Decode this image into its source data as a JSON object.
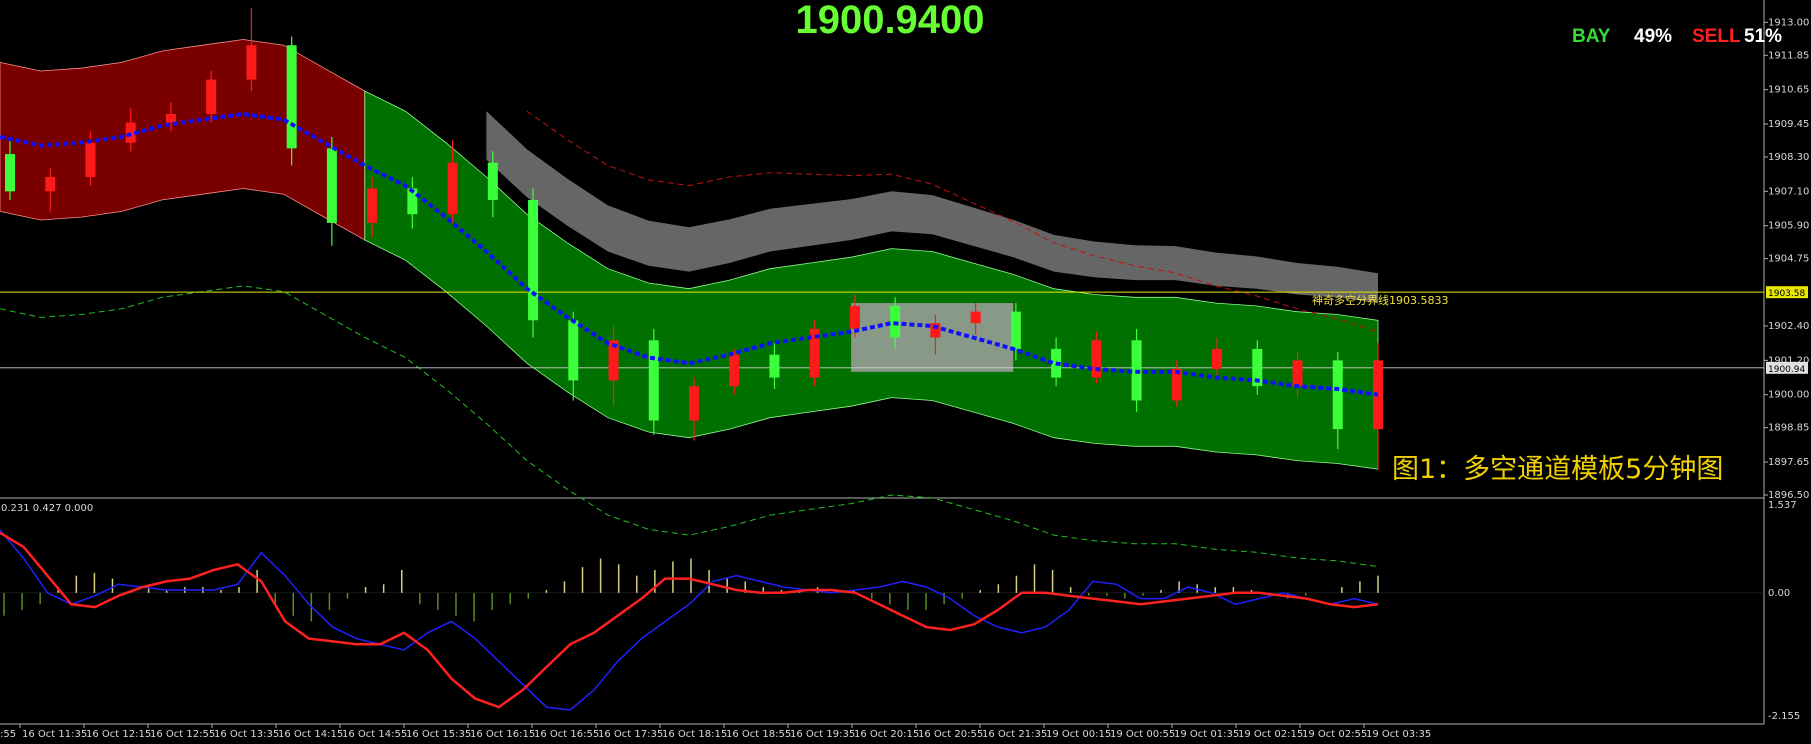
{
  "header": {
    "price": "1900.9400",
    "bay_label": "BAY",
    "bay_pct": "49%",
    "sell_label": "SELL",
    "sell_pct": "51%"
  },
  "colors": {
    "background": "#000000",
    "bull_candle": "#ff1a1a",
    "bear_candle": "#3cff3c",
    "bull_channel": "#7a0000",
    "bear_channel": "#007000",
    "grey_cloud": "#6b6b6b",
    "flat_zone": "#a0a0a0",
    "midline": "#1010ff",
    "signal_line": "#ff2020",
    "macd_line": "#2020ff",
    "boundary_line": "#e8e800",
    "price_text": "#66ff33",
    "caption": "#f0d000"
  },
  "chart_data": [
    {
      "type": "candlestick",
      "panel": "price",
      "y_ticks": [
        "1913.00",
        "1911.85",
        "1910.65",
        "1909.45",
        "1908.30",
        "1907.10",
        "1905.90",
        "1904.75",
        "1902.40",
        "1901.20",
        "1900.00",
        "1898.85",
        "1897.65",
        "1896.50"
      ],
      "ylim": [
        1896.5,
        1913.5
      ],
      "current_price_tag": "1900.94",
      "boundary": {
        "value": 1903.58,
        "tag": "1903.58",
        "label": "神奇多空分界线1903.5833"
      },
      "x_labels": [
        "16 Oct 11:35",
        "16 Oct 12:15",
        "16 Oct 12:55",
        "16 Oct 13:35",
        "16 Oct 14:15",
        "16 Oct 14:55",
        "16 Oct 15:35",
        "16 Oct 16:15",
        "16 Oct 16:55",
        "16 Oct 17:35",
        "16 Oct 18:15",
        "16 Oct 18:55",
        "16 Oct 19:35",
        "16 Oct 20:15",
        "16 Oct 20:55",
        "16 Oct 21:35",
        "19 Oct 00:15",
        "19 Oct 00:55",
        "19 Oct 01:35",
        "19 Oct 02:15",
        "19 Oct 02:55",
        "19 Oct 03:35"
      ],
      "x_label_leading": ":55",
      "caption": "图1：多空通道模板5分钟图",
      "midline": [
        1909.0,
        1908.7,
        1908.8,
        1909.0,
        1909.4,
        1909.6,
        1909.8,
        1909.6,
        1908.8,
        1908.0,
        1907.3,
        1906.2,
        1905.0,
        1903.7,
        1902.7,
        1901.8,
        1901.3,
        1901.1,
        1901.4,
        1901.8,
        1902.0,
        1902.2,
        1902.5,
        1902.4,
        1902.0,
        1901.6,
        1901.1,
        1900.9,
        1900.8,
        1900.8,
        1900.6,
        1900.5,
        1900.3,
        1900.2,
        1900.0
      ],
      "candles": [
        {
          "o": 1908.4,
          "h": 1908.9,
          "l": 1906.8,
          "c": 1907.1
        },
        {
          "o": 1907.1,
          "h": 1907.9,
          "l": 1906.4,
          "c": 1907.6
        },
        {
          "o": 1907.6,
          "h": 1909.2,
          "l": 1907.3,
          "c": 1908.8
        },
        {
          "o": 1908.8,
          "h": 1910.0,
          "l": 1908.5,
          "c": 1909.5
        },
        {
          "o": 1909.5,
          "h": 1910.2,
          "l": 1909.2,
          "c": 1909.8
        },
        {
          "o": 1909.8,
          "h": 1911.3,
          "l": 1909.5,
          "c": 1911.0
        },
        {
          "o": 1911.0,
          "h": 1913.5,
          "l": 1910.6,
          "c": 1912.2
        },
        {
          "o": 1912.2,
          "h": 1912.5,
          "l": 1908.0,
          "c": 1908.6
        },
        {
          "o": 1908.6,
          "h": 1909.0,
          "l": 1905.2,
          "c": 1906.0
        },
        {
          "o": 1906.0,
          "h": 1907.6,
          "l": 1905.5,
          "c": 1907.2
        },
        {
          "o": 1907.2,
          "h": 1907.6,
          "l": 1905.8,
          "c": 1906.3
        },
        {
          "o": 1906.3,
          "h": 1908.9,
          "l": 1906.0,
          "c": 1908.1
        },
        {
          "o": 1908.1,
          "h": 1908.5,
          "l": 1906.2,
          "c": 1906.8
        },
        {
          "o": 1906.8,
          "h": 1907.2,
          "l": 1902.0,
          "c": 1902.6
        },
        {
          "o": 1902.6,
          "h": 1902.9,
          "l": 1899.8,
          "c": 1900.5
        },
        {
          "o": 1900.5,
          "h": 1902.4,
          "l": 1899.6,
          "c": 1901.9
        },
        {
          "o": 1901.9,
          "h": 1902.3,
          "l": 1898.6,
          "c": 1899.1
        },
        {
          "o": 1899.1,
          "h": 1900.6,
          "l": 1898.4,
          "c": 1900.3
        },
        {
          "o": 1900.3,
          "h": 1901.6,
          "l": 1900.0,
          "c": 1901.4
        },
        {
          "o": 1901.4,
          "h": 1901.8,
          "l": 1900.2,
          "c": 1900.6
        },
        {
          "o": 1900.6,
          "h": 1902.6,
          "l": 1900.3,
          "c": 1902.3
        },
        {
          "o": 1902.3,
          "h": 1903.5,
          "l": 1902.0,
          "c": 1903.1
        },
        {
          "o": 1903.1,
          "h": 1903.4,
          "l": 1901.6,
          "c": 1902.0
        },
        {
          "o": 1902.0,
          "h": 1902.8,
          "l": 1901.4,
          "c": 1902.5
        },
        {
          "o": 1902.5,
          "h": 1903.2,
          "l": 1902.1,
          "c": 1902.9
        },
        {
          "o": 1902.9,
          "h": 1903.2,
          "l": 1901.2,
          "c": 1901.6
        },
        {
          "o": 1901.6,
          "h": 1902.0,
          "l": 1900.3,
          "c": 1900.6
        },
        {
          "o": 1900.6,
          "h": 1902.2,
          "l": 1900.4,
          "c": 1901.9
        },
        {
          "o": 1901.9,
          "h": 1902.3,
          "l": 1899.4,
          "c": 1899.8
        },
        {
          "o": 1899.8,
          "h": 1901.2,
          "l": 1899.6,
          "c": 1900.9
        },
        {
          "o": 1900.9,
          "h": 1902.0,
          "l": 1900.6,
          "c": 1901.6
        },
        {
          "o": 1901.6,
          "h": 1901.9,
          "l": 1900.0,
          "c": 1900.3
        },
        {
          "o": 1900.3,
          "h": 1901.5,
          "l": 1899.9,
          "c": 1901.2
        },
        {
          "o": 1901.2,
          "h": 1901.5,
          "l": 1898.1,
          "c": 1898.8
        },
        {
          "o": 1898.8,
          "h": 1901.8,
          "l": 1897.4,
          "c": 1901.2
        }
      ]
    },
    {
      "type": "macd",
      "panel": "indicator",
      "label": "0.231 0.427 0.000",
      "y_ticks": [
        "1.537",
        "0.00",
        "-2.155"
      ],
      "ylim": [
        -2.155,
        1.537
      ],
      "histogram": [
        -0.4,
        -0.3,
        -0.2,
        0.1,
        0.3,
        0.35,
        0.25,
        0.05,
        0.1,
        0.05,
        0.1,
        0.1,
        0.05,
        0.1,
        0.4,
        -0.2,
        -0.4,
        -0.5,
        -0.3,
        -0.1,
        0.1,
        0.15,
        0.4,
        -0.2,
        -0.3,
        -0.4,
        -0.5,
        -0.3,
        -0.2,
        -0.1,
        0.05,
        0.2,
        0.45,
        0.6,
        0.5,
        0.3,
        0.4,
        0.55,
        0.6,
        0.4,
        0.25,
        0.2,
        0.1,
        0.05,
        0.05,
        0.1,
        0.05,
        0.05,
        -0.1,
        -0.2,
        -0.3,
        -0.3,
        -0.2,
        -0.1,
        0.05,
        0.15,
        0.3,
        0.5,
        0.4,
        0.1,
        -0.05,
        -0.05,
        -0.1,
        -0.05,
        0.05,
        0.2,
        0.15,
        0.1,
        0.1,
        0.05,
        -0.05,
        -0.1,
        -0.05,
        0.0,
        0.1,
        0.2,
        0.3
      ],
      "macd": [
        1.1,
        0.6,
        0.0,
        -0.2,
        -0.05,
        0.15,
        0.1,
        0.05,
        0.05,
        0.05,
        0.15,
        0.7,
        0.3,
        -0.2,
        -0.6,
        -0.8,
        -0.9,
        -1.0,
        -0.7,
        -0.5,
        -0.8,
        -1.2,
        -1.6,
        -2.0,
        -2.05,
        -1.7,
        -1.2,
        -0.8,
        -0.5,
        -0.2,
        0.2,
        0.3,
        0.2,
        0.1,
        0.05,
        0.0,
        0.05,
        0.1,
        0.2,
        0.1,
        -0.1,
        -0.4,
        -0.6,
        -0.7,
        -0.6,
        -0.3,
        0.2,
        0.15,
        -0.1,
        -0.1,
        0.1,
        0.0,
        -0.2,
        -0.1,
        0.0,
        -0.1,
        -0.2,
        -0.1,
        -0.2
      ],
      "signal": [
        1.05,
        0.8,
        0.3,
        -0.2,
        -0.25,
        -0.05,
        0.1,
        0.2,
        0.25,
        0.4,
        0.5,
        0.2,
        -0.5,
        -0.8,
        -0.85,
        -0.9,
        -0.9,
        -0.7,
        -1.0,
        -1.5,
        -1.85,
        -2.0,
        -1.7,
        -1.3,
        -0.9,
        -0.7,
        -0.4,
        -0.1,
        0.25,
        0.25,
        0.15,
        0.05,
        0.0,
        0.0,
        0.05,
        0.05,
        0.0,
        -0.2,
        -0.4,
        -0.6,
        -0.65,
        -0.55,
        -0.3,
        0.0,
        0.0,
        -0.05,
        -0.1,
        -0.15,
        -0.2,
        -0.15,
        -0.1,
        -0.05,
        0.0,
        0.0,
        -0.05,
        -0.1,
        -0.2,
        -0.25,
        -0.2
      ]
    }
  ]
}
